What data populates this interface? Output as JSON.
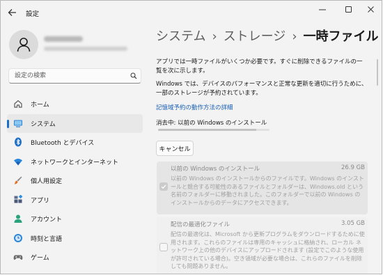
{
  "window": {
    "title": "設定",
    "controls": [
      "minimize-icon",
      "maximize-icon",
      "close-icon"
    ]
  },
  "search": {
    "placeholder": "設定の検索"
  },
  "sidebar": {
    "items": [
      {
        "label": "ホーム",
        "icon": "home-icon",
        "active": false
      },
      {
        "label": "システム",
        "icon": "system-display-icon",
        "active": true
      },
      {
        "label": "Bluetooth とデバイス",
        "icon": "bluetooth-icon",
        "active": false
      },
      {
        "label": "ネットワークとインターネット",
        "icon": "wifi-icon",
        "active": false
      },
      {
        "label": "個人用設定",
        "icon": "brush-icon",
        "active": false
      },
      {
        "label": "アプリ",
        "icon": "apps-icon",
        "active": false
      },
      {
        "label": "アカウント",
        "icon": "account-icon",
        "active": false
      },
      {
        "label": "時刻と言語",
        "icon": "time-language-icon",
        "active": false
      },
      {
        "label": "ゲーム",
        "icon": "gamepad-icon",
        "active": false
      }
    ]
  },
  "breadcrumb": {
    "crumb1": "システム",
    "crumb2": "ストレージ",
    "current": "一時ファイル",
    "separator": "›"
  },
  "content": {
    "intro": "アプリでは一時ファイルがいくつか必要です。すぐに削除できるファイルの一覧を次に示します。",
    "reserved": "Windows では、デバイスのパフォーマンスと正常な更新を適切に行うために、一部のストレージが予約されています。",
    "link": "記憶域予約の動作方法の詳細",
    "status": "消去中: 以前の Windows のインストール",
    "progress": 0.88,
    "cancel_label": "キャンセル",
    "items": [
      {
        "title": "以前の Windows のインストール",
        "size": "26.9 GB",
        "checked": true,
        "description": "以前の Windows のインストールからのファイルです。Windows のインストールと競合する可能性のあるファイルとフォルダーは、Windows.old という名前のフォルダーに移動されました。このフォルダーで以前の Windows のインストールからのデータにアクセスできます。"
      },
      {
        "title": "配信の最適化ファイル",
        "size": "3.05 GB",
        "checked": false,
        "description": "配信の最適化は、Microsoft から更新プログラムをダウンロードするために使用されます。これらのファイルは専用のキャッシュに格納され、ローカル ネットワーク上の他のデバイスにアップロードされます (設定でこのような使用が許可されている場合)。空き領域が必要な場合は、これらのファイルを削除しても問題ありません。"
      }
    ]
  },
  "colors": {
    "accent": "#1a6fc6",
    "link": "#1a5fb4",
    "window_bg": "#f3f3f3"
  }
}
